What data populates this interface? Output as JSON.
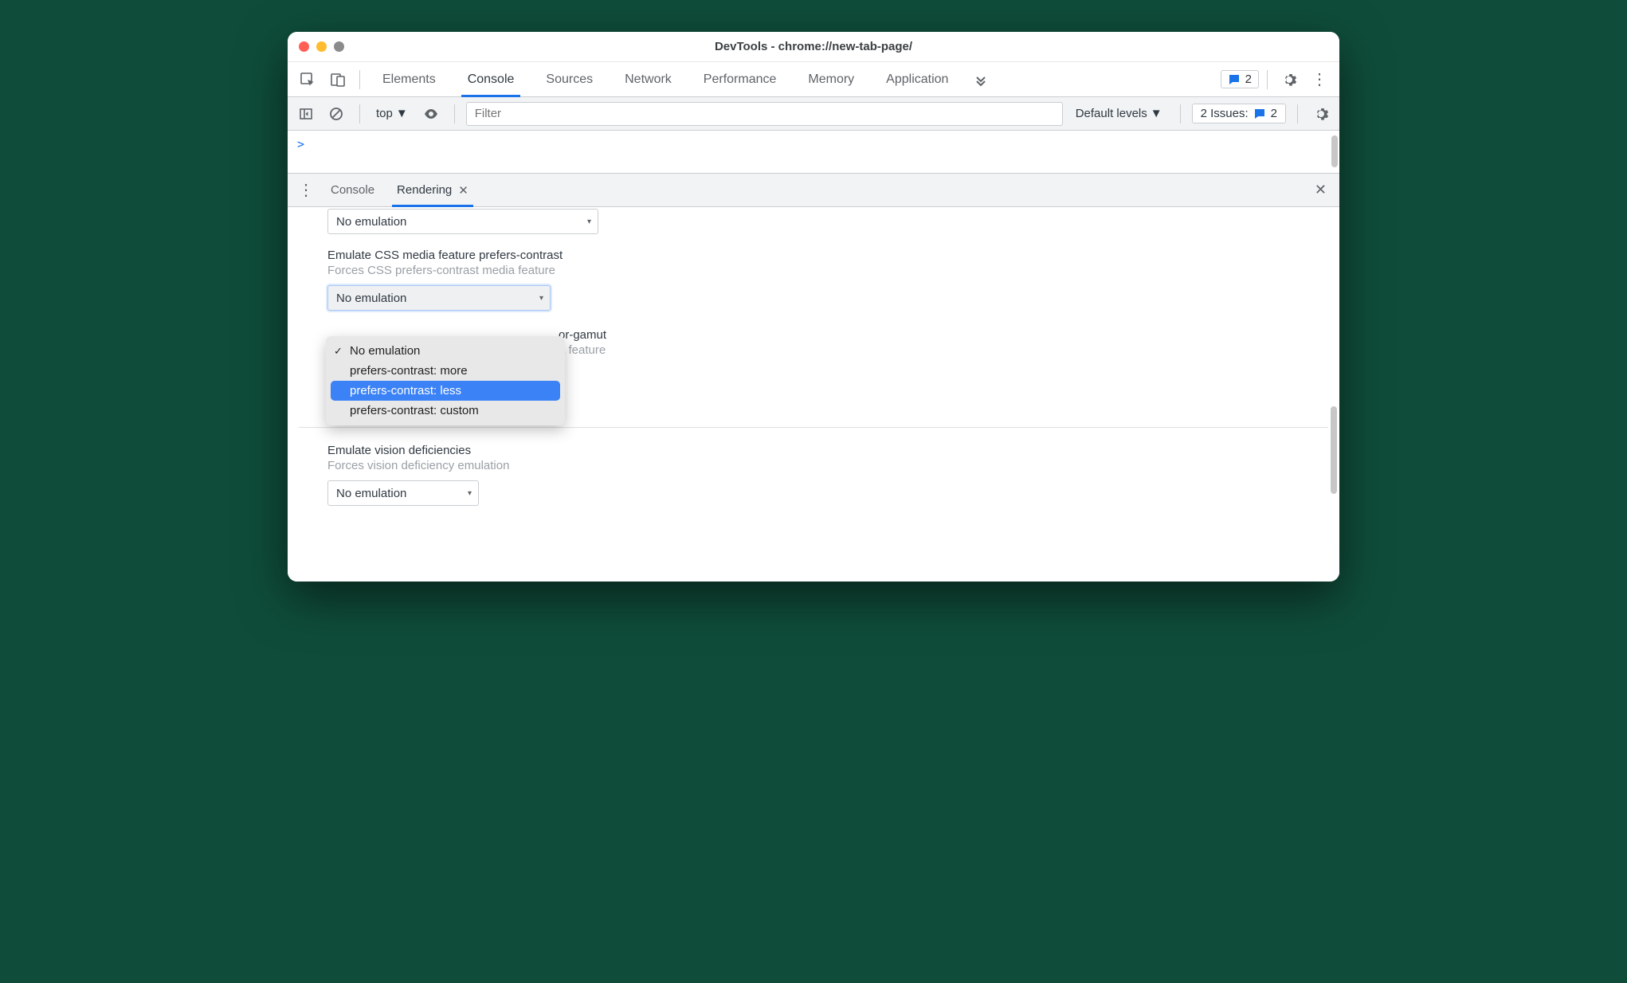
{
  "window": {
    "title": "DevTools - chrome://new-tab-page/"
  },
  "tabs": {
    "items": [
      "Elements",
      "Console",
      "Sources",
      "Network",
      "Performance",
      "Memory",
      "Application"
    ],
    "active_index": 1,
    "feedback_count": "2"
  },
  "toolbar": {
    "context": "top",
    "filter_placeholder": "Filter",
    "levels": "Default levels",
    "issues_label": "2 Issues:",
    "issues_count": "2"
  },
  "console": {
    "prompt": ">"
  },
  "drawer": {
    "tabs": [
      "Console",
      "Rendering"
    ],
    "active_index": 1
  },
  "rendering": {
    "prev_select_value": "No emulation",
    "contrast": {
      "title": "Emulate CSS media feature prefers-contrast",
      "desc": "Forces CSS prefers-contrast media feature",
      "value": "No emulation",
      "options": [
        "No emulation",
        "prefers-contrast: more",
        "prefers-contrast: less",
        "prefers-contrast: custom"
      ],
      "selected_index": 0,
      "highlighted_index": 2
    },
    "gamut": {
      "title_partial": "or-gamut",
      "desc_partial": "a feature"
    },
    "vision": {
      "title": "Emulate vision deficiencies",
      "desc": "Forces vision deficiency emulation",
      "value": "No emulation"
    }
  }
}
